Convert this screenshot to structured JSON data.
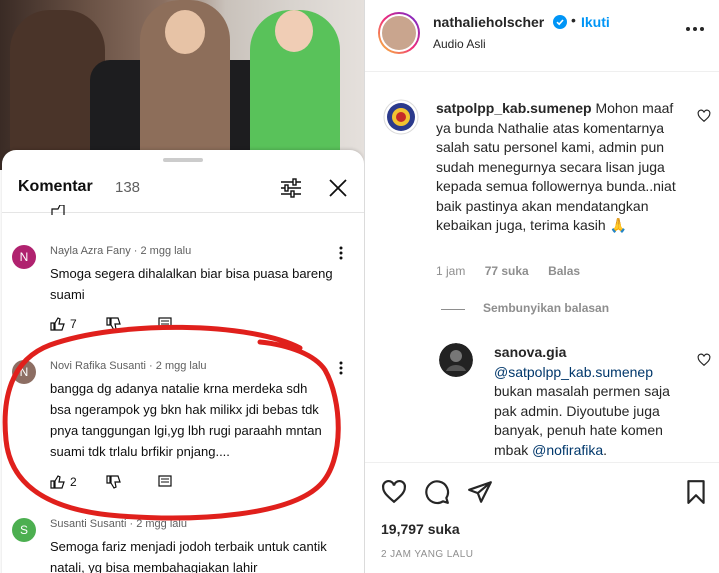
{
  "youtube": {
    "sheet_title": "Komentar",
    "comment_count": "138",
    "comments": [
      {
        "initial": "N",
        "author": "Nayla Azra Fany",
        "time": "2 mgg lalu",
        "text": "Smoga segera dihalalkan biar bisa puasa bareng suami",
        "likes": "7",
        "avatar_color": "#b0226f"
      },
      {
        "initial": "N",
        "author": "Novi Rafika Susanti",
        "time": "2 mgg lalu",
        "text": "bangga dg adanya natalie krna merdeka sdh bsa ngerampok yg bkn hak milikx jdi bebas tdk pnya tanggungan lgi,yg lbh rugi paraahh mntan suami tdk trlalu brfikir pnjang....",
        "likes": "2",
        "avatar_color": "#8d6e63"
      },
      {
        "initial": "S",
        "author": "Susanti Susanti",
        "time": "2 mgg lalu",
        "text": "Semoga fariz menjadi jodoh terbaik untuk cantik natali, yg bisa membahagiakan lahir",
        "likes": "",
        "avatar_color": "#4caf50"
      }
    ],
    "meta_separator": " · "
  },
  "instagram": {
    "username": "nathalieholscher",
    "follow_label": "Ikuti",
    "dot": "•",
    "audio": "Audio Asli",
    "comments": [
      {
        "username": "satpolpp_kab.sumenep",
        "text": "Mohon maaf ya bunda Nathalie atas komentarnya salah satu personel kami, admin pun sudah menegurnya secara lisan juga kepada semua followernya bunda..niat baik pastinya akan mendatangkan kebaikan juga, terima kasih 🙏",
        "time": "1 jam",
        "likes": "77 suka",
        "reply": "Balas"
      }
    ],
    "hide_replies": "Sembunyikan balasan",
    "reply": {
      "username": "sanova.gia",
      "mention1": "@satpolpp_kab.sumenep",
      "text": "bukan masalah permen saja pak admin. Diyoutube juga banyak, penuh hate komen mbak",
      "mention2": "@nofirafika",
      "end": "."
    },
    "like_count": "19,797 suka",
    "time_ago": "2 JAM YANG LALU"
  },
  "colors": {
    "accent_blue": "#0095f6",
    "verified": "#0095f6",
    "annotation_red": "#e0201c"
  },
  "icons": [
    "filter-icon",
    "close-icon",
    "thumb-up-icon",
    "thumb-down-icon",
    "reply-icon",
    "more-vert-icon",
    "verified-icon",
    "more-horiz-icon",
    "heart-icon",
    "comment-icon",
    "share-icon",
    "bookmark-icon"
  ]
}
